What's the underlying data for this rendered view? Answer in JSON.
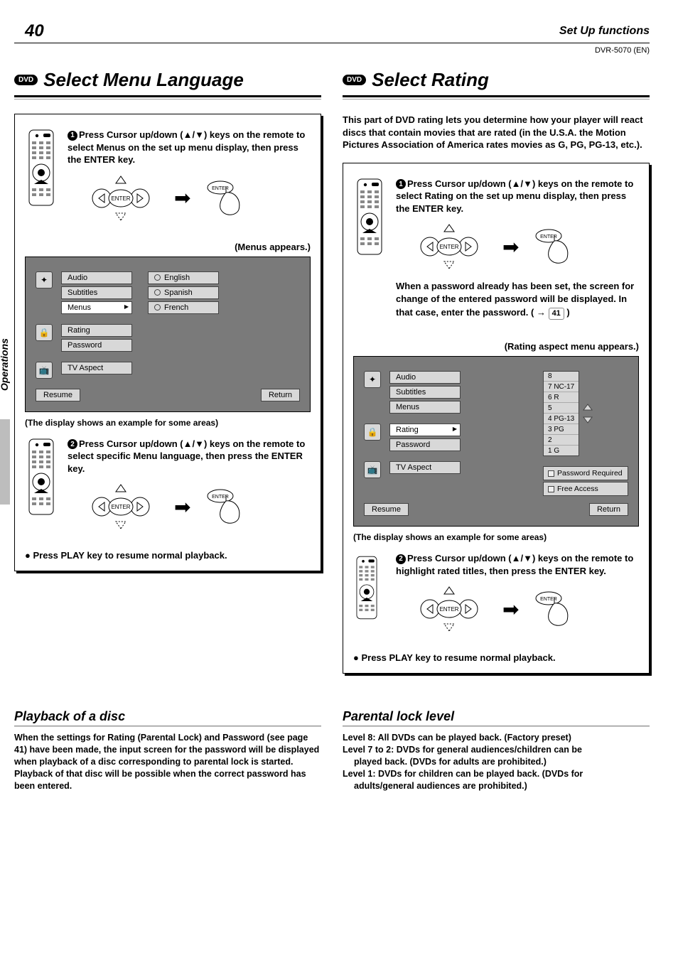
{
  "page_number": "40",
  "section_title": "Set Up functions",
  "model_code": "DVR-5070 (EN)",
  "sidebar_label": "Operations",
  "dvd_chip": "DVD",
  "enter_label": "ENTER",
  "left": {
    "heading": "Select Menu Language",
    "step1": "Press Cursor up/down (▲/▼) keys on the remote to select Menus on the set up menu display, then press the ENTER key.",
    "menus_appears": "(Menus appears.)",
    "osd": {
      "group1": [
        "Audio",
        "Subtitles",
        "Menus"
      ],
      "group1_selected": "Menus",
      "options": [
        "English",
        "Spanish",
        "French"
      ],
      "group2": [
        "Rating",
        "Password"
      ],
      "group3": [
        "TV Aspect"
      ],
      "resume": "Resume",
      "return": "Return"
    },
    "example_caption": "(The display shows an example for some areas)",
    "step2": "Press Cursor up/down (▲/▼) keys on the remote to select specific Menu language, then press the ENTER key.",
    "bullet": "●  Press PLAY key to resume normal playback."
  },
  "right": {
    "heading": "Select Rating",
    "intro": "This part of DVD rating lets you determine how your player will react discs that contain movies that are rated (in the U.S.A. the Motion Pictures Association of America rates movies as G, PG, PG-13, etc.).",
    "step1": "Press Cursor up/down (▲/▼) keys on the remote to select Rating on the set up menu display, then press the ENTER key.",
    "password_note_1": "When a password already has been set, the screen for change of the entered password will be displayed. In that case, enter the password. ( → ",
    "password_note_ref": "41",
    "password_note_2": " )",
    "rating_appears": "(Rating aspect menu appears.)",
    "osd": {
      "group1": [
        "Audio",
        "Subtitles",
        "Menus"
      ],
      "group2": [
        "Rating",
        "Password"
      ],
      "group2_selected": "Rating",
      "group3": [
        "TV Aspect"
      ],
      "levels": [
        "8",
        "7 NC-17",
        "6 R",
        "5",
        "4 PG-13",
        "3 PG",
        "2",
        "1 G"
      ],
      "extra": [
        "Password Required",
        "Free Access"
      ],
      "resume": "Resume",
      "return": "Return"
    },
    "example_caption": "(The display shows an example for some areas)",
    "step2": "Press Cursor up/down (▲/▼) keys on the remote to highlight rated titles, then press the ENTER key.",
    "bullet": "●  Press PLAY key to resume normal playback."
  },
  "lower_left": {
    "heading": "Playback of a disc",
    "body": "When the settings for Rating (Parental Lock) and Password (see page 41) have been made, the input screen for the password will be displayed when playback of a disc corresponding to parental lock is started. Playback of that disc will be possible when the correct password has been entered."
  },
  "lower_right": {
    "heading": "Parental lock level",
    "l8": "Level 8: All DVDs can be played back. (Factory preset)",
    "l72a": "Level 7 to 2: DVDs  for general audiences/children can be",
    "l72b": "played back. (DVDs for adults are prohibited.)",
    "l1a": "Level 1: DVDs for children can be played back. (DVDs for",
    "l1b": "adults/general audiences are prohibited.)"
  },
  "step_num_1": "1",
  "step_num_2": "2"
}
